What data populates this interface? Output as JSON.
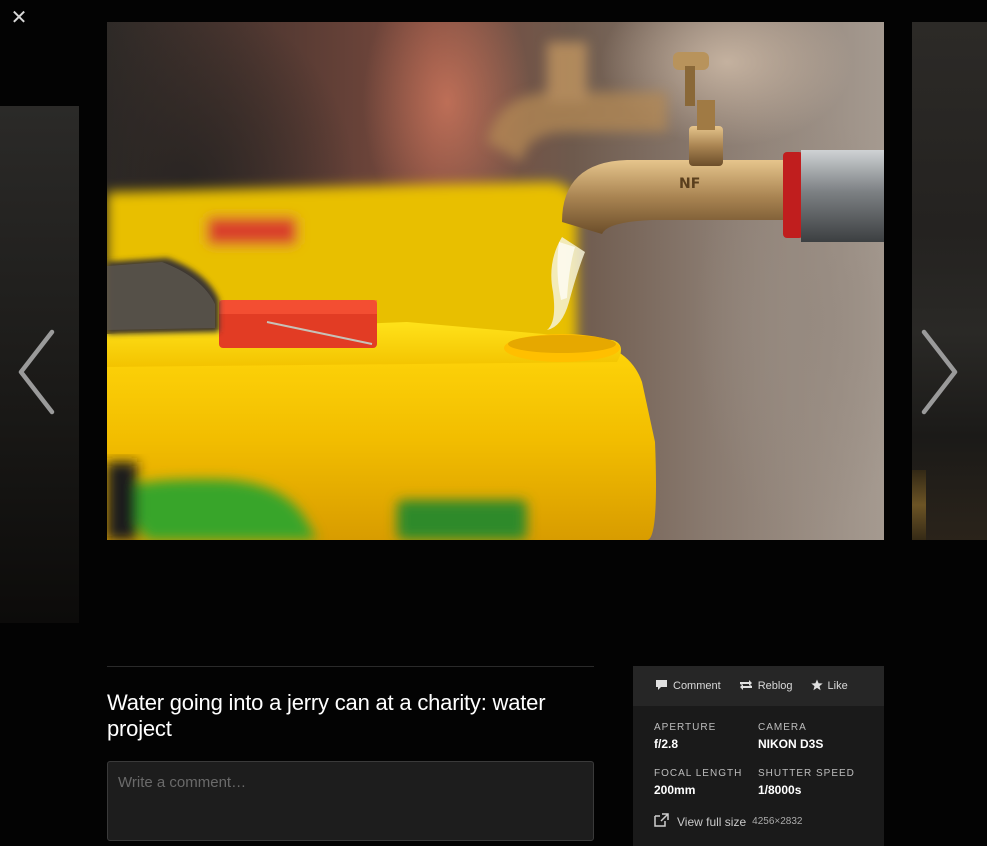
{
  "viewer": {
    "close_glyph": "✕"
  },
  "post": {
    "title": "Water going into a jerry can at a charity: water project",
    "comment_placeholder": "Write a comment…"
  },
  "actions": {
    "comment": "Comment",
    "reblog": "Reblog",
    "like": "Like"
  },
  "exif": {
    "aperture_label": "APERTURE",
    "aperture": "f/2.8",
    "camera_label": "CAMERA",
    "camera": "NIKON D3S",
    "focal_label": "FOCAL LENGTH",
    "focal": "200mm",
    "shutter_label": "SHUTTER SPEED",
    "shutter": "1/8000s"
  },
  "full_size": {
    "label": "View full size",
    "dimensions": "4256×2832"
  },
  "photo": {
    "tap_mark": "NF"
  }
}
